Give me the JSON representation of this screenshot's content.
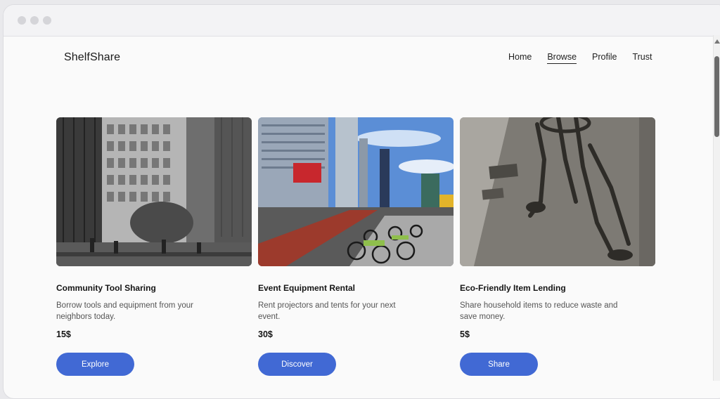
{
  "brand": "ShelfShare",
  "nav": {
    "items": [
      "Home",
      "Browse",
      "Profile",
      "Trust"
    ],
    "active": "Browse"
  },
  "cards": [
    {
      "title": "Community Tool Sharing",
      "description": "Borrow tools and equipment from your neighbors today.",
      "price": "15$",
      "button": "Explore",
      "image": "grayscale city office buildings plaza"
    },
    {
      "title": "Event Equipment Rental",
      "description": "Rent projectors and tents for your next event.",
      "price": "30$",
      "button": "Discover",
      "image": "city street with bike share rack and skyscrapers"
    },
    {
      "title": "Eco-Friendly Item Lending",
      "description": "Share household items to reduce waste and save money.",
      "price": "5$",
      "button": "Share",
      "image": "bicycle shadows on sidewalk"
    }
  ],
  "colors": {
    "accent": "#4169d4",
    "background": "#fafafa"
  }
}
